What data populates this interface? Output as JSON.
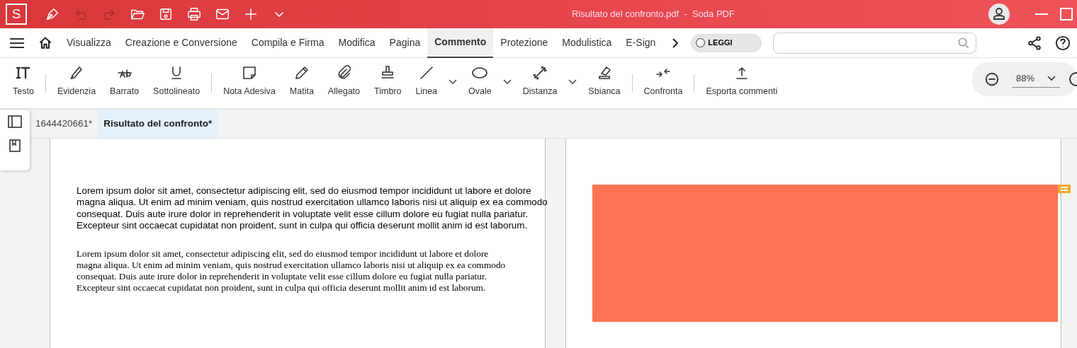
{
  "title_bar": {
    "logo": "S",
    "title": "Risultato del confronto.pdf  -  Soda PDF",
    "quick_actions": [
      {
        "kind": "pen",
        "disabled": false
      },
      {
        "kind": "undo",
        "disabled": true
      },
      {
        "kind": "redo",
        "disabled": true
      },
      {
        "kind": "open",
        "disabled": false
      },
      {
        "kind": "save",
        "disabled": false
      },
      {
        "kind": "print",
        "disabled": false
      },
      {
        "kind": "mail",
        "disabled": false
      },
      {
        "kind": "plus",
        "disabled": false
      },
      {
        "kind": "chevron",
        "disabled": false
      }
    ]
  },
  "menu": {
    "tabs": [
      {
        "label": "Visualizza",
        "selected": false
      },
      {
        "label": "Creazione e Conversione",
        "selected": false
      },
      {
        "label": "Compila e Firma",
        "selected": false
      },
      {
        "label": "Modifica",
        "selected": false
      },
      {
        "label": "Pagina",
        "selected": false
      },
      {
        "label": "Commento",
        "selected": true
      },
      {
        "label": "Protezione",
        "selected": false
      },
      {
        "label": "Modulistica",
        "selected": false
      },
      {
        "label": "E-Sign",
        "selected": false
      }
    ],
    "read_mode": {
      "label": "LEGGI",
      "on": false
    }
  },
  "toolbar": [
    {
      "kind": "text",
      "label": "Testo",
      "dropdown": false
    },
    {
      "kind": "separator"
    },
    {
      "kind": "highlight",
      "label": "Evidenzia",
      "dropdown": false
    },
    {
      "kind": "strike",
      "label": "Barrato",
      "dropdown": false
    },
    {
      "kind": "underline",
      "label": "Sottolineato",
      "dropdown": false
    },
    {
      "kind": "separator"
    },
    {
      "kind": "note",
      "label": "Nota Adesiva",
      "dropdown": false
    },
    {
      "kind": "pencil",
      "label": "Matita",
      "dropdown": false
    },
    {
      "kind": "clip",
      "label": "Allegato",
      "dropdown": false
    },
    {
      "kind": "stamp",
      "label": "Timbro",
      "dropdown": false
    },
    {
      "kind": "line",
      "label": "Linea",
      "dropdown": true
    },
    {
      "kind": "oval",
      "label": "Ovale",
      "dropdown": true
    },
    {
      "kind": "distance",
      "label": "Distanza",
      "dropdown": true
    },
    {
      "kind": "eraser",
      "label": "Sbianca",
      "dropdown": false
    },
    {
      "kind": "separator"
    },
    {
      "kind": "compare",
      "label": "Confronta",
      "dropdown": false
    },
    {
      "kind": "separator"
    },
    {
      "kind": "export",
      "label": "Esporta commenti",
      "dropdown": false
    }
  ],
  "zoom": {
    "value": "88%"
  },
  "doc_tabs": [
    {
      "label": "1644420661*",
      "selected": false
    },
    {
      "label": "Risultato del confronto*",
      "selected": true
    }
  ],
  "left_page": {
    "paragraphs": [
      {
        "kind": "sans",
        "text": "Lorem ipsum dolor sit amet, consectetur adipiscing elit, sed do eiusmod tempor incididunt ut labore et dolore magna aliqua. Ut enim ad minim veniam, quis nostrud exercitation ullamco laboris nisi ut aliquip ex ea commodo consequat. Duis aute irure dolor in reprehenderit in voluptate velit esse cillum dolore eu fugiat nulla pariatur. Excepteur sint occaecat cupidatat non proident, sunt in culpa qui officia deserunt mollit anim id est laborum."
      },
      {
        "kind": "serif",
        "text": "Lorem ipsum dolor sit amet, consectetur adipiscing elit, sed do eiusmod tempor incididunt ut labore et dolore magna aliqua. Ut enim ad minim veniam, quis nostrud exercitation ullamco laboris nisi ut aliquip ex ea commodo consequat. Duis aute irure dolor in reprehenderit in voluptate velit esse cillum dolore eu fugiat nulla pariatur. Excepteur sint occaecat cupidatat non proident, sunt in culpa qui officia deserunt mollit anim id est laborum."
      }
    ]
  },
  "right_page": {
    "highlight": {
      "color": "#ff7355"
    },
    "comment_marker": {
      "color": "#f0a830"
    }
  }
}
